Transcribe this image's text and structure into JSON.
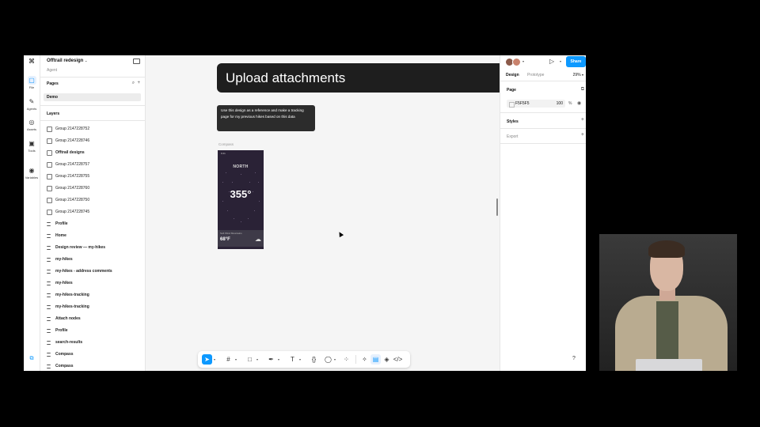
{
  "project": {
    "title": "Offtrail redesign",
    "subtitle": "Agent"
  },
  "rail": {
    "items": [
      {
        "label": "File",
        "icon": "file-icon",
        "glyph": "▢"
      },
      {
        "label": "Agents",
        "icon": "agents-icon",
        "glyph": "✎"
      },
      {
        "label": "Assets",
        "icon": "assets-icon",
        "glyph": "◎"
      },
      {
        "label": "Tools",
        "icon": "tools-icon",
        "glyph": "▣"
      },
      {
        "label": "Variables",
        "icon": "variables-icon",
        "glyph": "◉"
      }
    ]
  },
  "pages": {
    "header": "Pages",
    "items": [
      "Demo"
    ]
  },
  "layers": {
    "header": "Layers",
    "items": [
      {
        "name": "Group 2147228752",
        "type": "group",
        "bold": false
      },
      {
        "name": "Group 2147228746",
        "type": "group",
        "bold": false
      },
      {
        "name": "Offtrail designs",
        "type": "section",
        "bold": true
      },
      {
        "name": "Group 2147228757",
        "type": "group",
        "bold": false
      },
      {
        "name": "Group 2147228755",
        "type": "group",
        "bold": false
      },
      {
        "name": "Group 2147228760",
        "type": "group",
        "bold": false
      },
      {
        "name": "Group 2147228750",
        "type": "group",
        "bold": false
      },
      {
        "name": "Group 2147228745",
        "type": "group",
        "bold": false
      },
      {
        "name": "Profile",
        "type": "frame",
        "bold": true
      },
      {
        "name": "Home",
        "type": "frame",
        "bold": true
      },
      {
        "name": "Design review — my-hikes",
        "type": "frame",
        "bold": true
      },
      {
        "name": "my-hikes",
        "type": "frame",
        "bold": true
      },
      {
        "name": "my-hikes - address comments",
        "type": "frame",
        "bold": true
      },
      {
        "name": "my-hikes",
        "type": "frame",
        "bold": true
      },
      {
        "name": "my-hikes-tracking",
        "type": "frame",
        "bold": true
      },
      {
        "name": "my-hikes-tracking",
        "type": "frame",
        "bold": true
      },
      {
        "name": "Attach nodes",
        "type": "frame",
        "bold": true
      },
      {
        "name": "Profile",
        "type": "frame",
        "bold": true
      },
      {
        "name": "search-results",
        "type": "frame",
        "bold": true
      },
      {
        "name": "Compass",
        "type": "frame",
        "bold": true
      },
      {
        "name": "Compass",
        "type": "frame",
        "bold": true
      }
    ]
  },
  "canvas": {
    "banner": "Upload attachments",
    "tooltip": "Use this design as a reference and make a tracking page for my previous hikes based on this data",
    "frame_label": "Compass",
    "phone": {
      "status_time": "9:41",
      "heading": "NORTH",
      "degrees": "355°",
      "location": "Soft Wind Mountains",
      "temperature": "68°F"
    }
  },
  "toolbar": {
    "tools": [
      "move-tool",
      "frame-tool",
      "shape-tool",
      "pen-tool",
      "text-tool",
      "code-tool",
      "comment-tool",
      "components-tool"
    ],
    "modes": [
      "design-mode",
      "dev-mode",
      "prototype-mode",
      "code-mode"
    ]
  },
  "right_panel": {
    "share_label": "Share",
    "tabs": [
      "Design",
      "Prototype"
    ],
    "zoom": "29%",
    "page_label": "Page",
    "page_color": "F5F5F5",
    "page_opacity": "100",
    "opacity_unit": "%",
    "styles_label": "Styles",
    "export_label": "Export",
    "help": "?"
  },
  "colors": {
    "accent": "#0d99ff",
    "banner_bg": "#1e1e1e",
    "canvas_bg": "#f5f5f5",
    "phone_bg": "#2a2236"
  }
}
